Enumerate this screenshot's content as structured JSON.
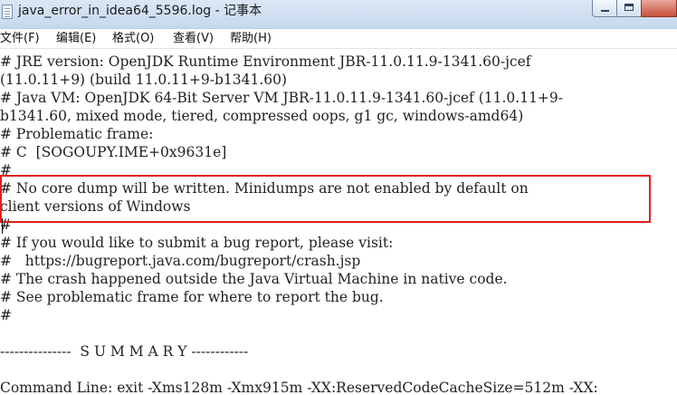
{
  "window": {
    "title": "java_error_in_idea64_5596.log - 记事本"
  },
  "menu": [
    "文件(F)",
    "编辑(E)",
    "格式(O)",
    "查看(V)",
    "帮助(H)"
  ],
  "content": {
    "lines": [
      "# JRE version: OpenJDK Runtime Environment JBR-11.0.11.9-1341.60-jcef",
      "(11.0.11+9) (build 11.0.11+9-b1341.60)",
      "# Java VM: OpenJDK 64-Bit Server VM JBR-11.0.11.9-1341.60-jcef (11.0.11+9-",
      "b1341.60, mixed mode, tiered, compressed oops, g1 gc, windows-amd64)",
      "# Problematic frame:",
      "# C  [SOGOUPY.IME+0x9631e]",
      "#",
      "# No core dump will be written. Minidumps are not enabled by default on",
      "client versions of Windows",
      "#",
      "# If you would like to submit a bug report, please visit:",
      "#   https://bugreport.java.com/bugreport/crash.jsp",
      "# The crash happened outside the Java Virtual Machine in native code.",
      "# See problematic frame for where to report the bug.",
      "#",
      "",
      "---------------  S U M M A R Y ------------",
      "",
      "Command Line: exit -Xms128m -Xmx915m -XX:ReservedCodeCacheSize=512m -XX:"
    ]
  },
  "colors": {
    "highlight_border": "#e02020",
    "titlebar": "#c6d8ee"
  }
}
